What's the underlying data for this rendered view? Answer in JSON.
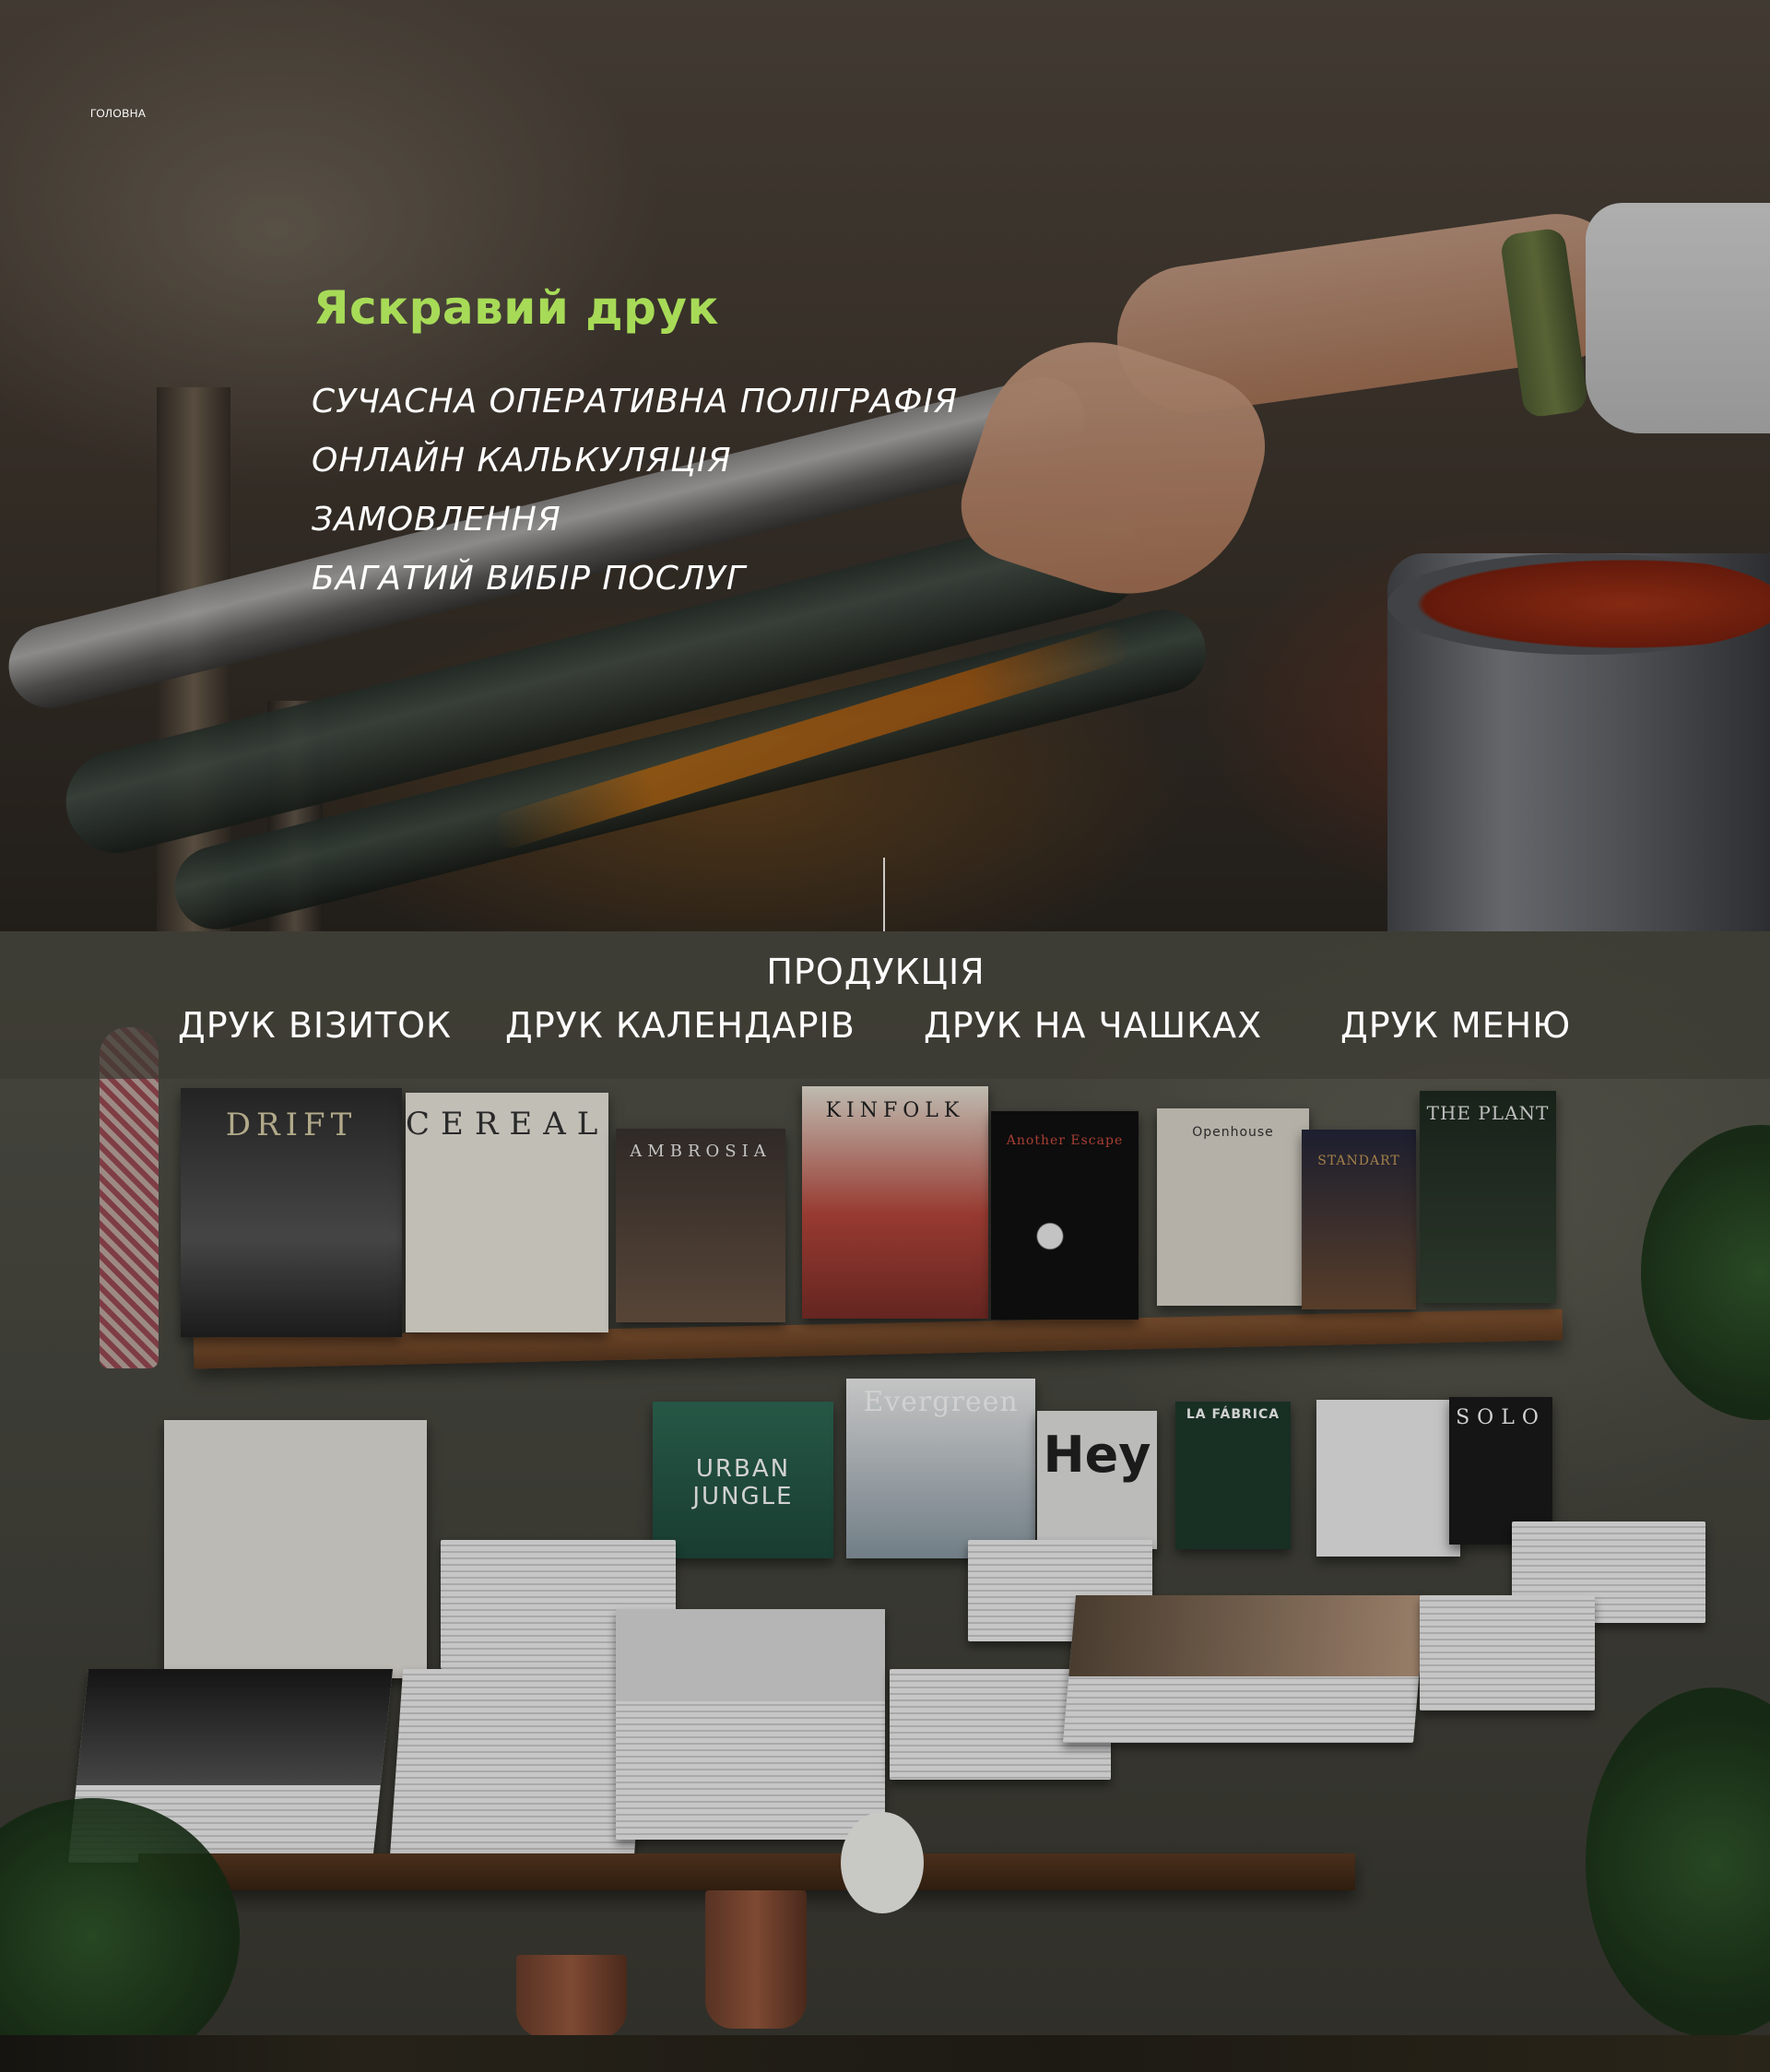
{
  "nav": {
    "breadcrumb": "Головна"
  },
  "hero": {
    "brand": "Яскравий друк",
    "features": [
      "Сучасна оперативна поліграфія",
      "Онлайн калькуляція",
      "Замовлення",
      "Багатий вибір послуг"
    ]
  },
  "products": {
    "title": "Продукція",
    "items": [
      {
        "label": "Друк візиток"
      },
      {
        "label": "Друк календарів"
      },
      {
        "label": "Друк на чашках"
      },
      {
        "label": "Друк меню"
      }
    ]
  },
  "photo_text": {
    "magazines": [
      "DRIFT",
      "CEREAL",
      "AMBROSIA",
      "KINFOLK",
      "Another Escape",
      "Openhouse",
      "STANDART",
      "THE PLANT",
      "URBAN JUNGLE",
      "Evergreen",
      "Hey",
      "LA FÁBRICA",
      "SOLO"
    ]
  },
  "colors": {
    "brand_green": "#a7db57",
    "text_white": "#ffffff",
    "header_bar": "#3c3a32"
  }
}
